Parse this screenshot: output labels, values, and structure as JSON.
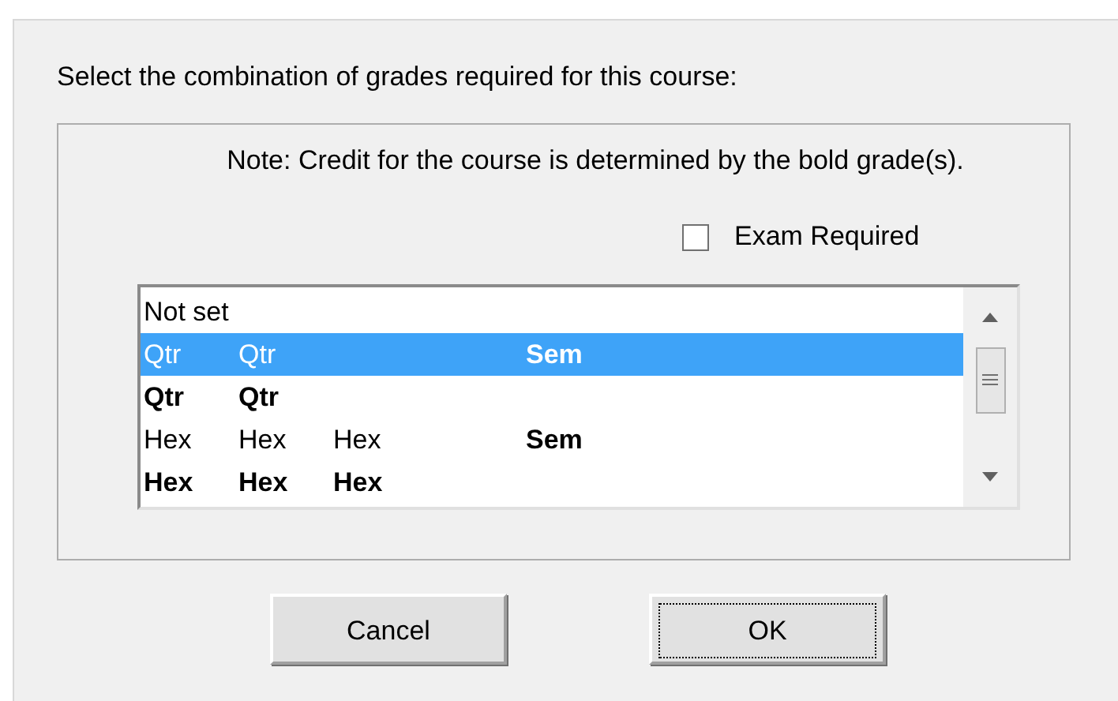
{
  "dialog": {
    "prompt": "Select the combination of grades required for this course:",
    "note": "Note: Credit for the course is determined by the bold grade(s).",
    "exam_required": {
      "label": "Exam Required",
      "checked": false
    },
    "list": {
      "rows": [
        {
          "selected": false,
          "cells": {
            "column_1": {
              "text": "Not set",
              "bold": false
            }
          }
        },
        {
          "selected": true,
          "cells": {
            "column_1": {
              "text": "Qtr",
              "bold": false
            },
            "column_2": {
              "text": "Qtr",
              "bold": false
            },
            "column_4": {
              "text": "Sem",
              "bold": true
            }
          }
        },
        {
          "selected": false,
          "cells": {
            "column_1": {
              "text": "Qtr",
              "bold": true
            },
            "column_2": {
              "text": "Qtr",
              "bold": true
            }
          }
        },
        {
          "selected": false,
          "cells": {
            "column_1": {
              "text": "Hex",
              "bold": false
            },
            "column_2": {
              "text": "Hex",
              "bold": false
            },
            "column_3": {
              "text": "Hex",
              "bold": false
            },
            "column_4": {
              "text": "Sem",
              "bold": true
            }
          }
        },
        {
          "selected": false,
          "cells": {
            "column_1": {
              "text": "Hex",
              "bold": true
            },
            "column_2": {
              "text": "Hex",
              "bold": true
            },
            "column_3": {
              "text": "Hex",
              "bold": true
            }
          }
        }
      ]
    },
    "buttons": [
      {
        "label": "Cancel",
        "focused": false
      },
      {
        "label": "OK",
        "focused": true
      }
    ]
  }
}
